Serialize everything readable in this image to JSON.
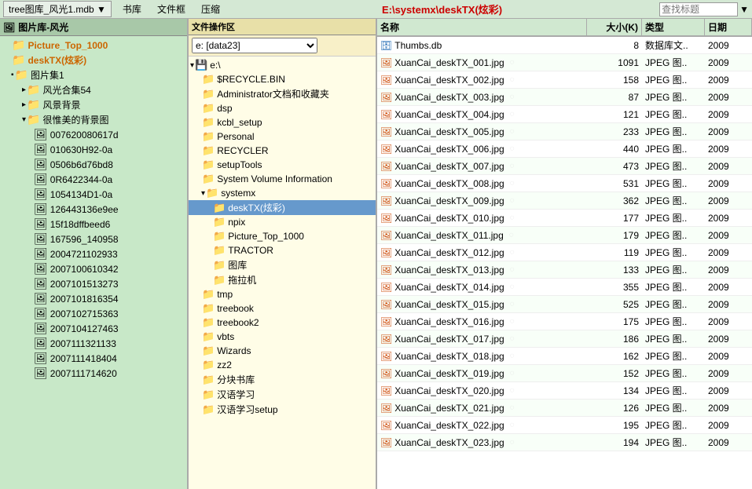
{
  "menubar": {
    "title_dropdown": "tree图库_风光1.mdb ▼",
    "menu_items": [
      "书库",
      "文件框",
      "压缩"
    ],
    "path": "E:\\systemx\\deskTX(炫彩)",
    "search_placeholder": "查找标题"
  },
  "left_panel": {
    "header_icon": "🖼",
    "header_label": "图片库-风光",
    "items": [
      {
        "label": "Picture_Top_1000",
        "indent": 1,
        "bold": true,
        "expand": "",
        "icon": "📁"
      },
      {
        "label": "deskTX(炫彩)",
        "indent": 1,
        "bold": true,
        "expand": "",
        "icon": "📁"
      },
      {
        "label": "图片集1",
        "indent": 1,
        "bold": false,
        "expand": "▪",
        "icon": "📁"
      },
      {
        "label": "风光合集54",
        "indent": 2,
        "bold": false,
        "expand": "▸",
        "icon": "📁"
      },
      {
        "label": "风景背景",
        "indent": 2,
        "bold": false,
        "expand": "▸",
        "icon": "📁"
      },
      {
        "label": "很惟美的背景图",
        "indent": 2,
        "bold": false,
        "expand": "▾",
        "icon": "📁"
      },
      {
        "label": "007620080617d",
        "indent": 3,
        "bold": false,
        "expand": "",
        "icon": "🖼"
      },
      {
        "label": "010630H92-0a",
        "indent": 3,
        "bold": false,
        "expand": "",
        "icon": "🖼"
      },
      {
        "label": "0506b6d76bd8",
        "indent": 3,
        "bold": false,
        "expand": "",
        "icon": "🖼"
      },
      {
        "label": "0R6422344-0a",
        "indent": 3,
        "bold": false,
        "expand": "",
        "icon": "🖼"
      },
      {
        "label": "1054134D1-0a",
        "indent": 3,
        "bold": false,
        "expand": "",
        "icon": "🖼"
      },
      {
        "label": "126443136e9ee",
        "indent": 3,
        "bold": false,
        "expand": "",
        "icon": "🖼"
      },
      {
        "label": "15f18dffbeed6",
        "indent": 3,
        "bold": false,
        "expand": "",
        "icon": "🖼"
      },
      {
        "label": "167596_140958",
        "indent": 3,
        "bold": false,
        "expand": "",
        "icon": "🖼"
      },
      {
        "label": "2004721102933",
        "indent": 3,
        "bold": false,
        "expand": "",
        "icon": "🖼"
      },
      {
        "label": "2007100610342",
        "indent": 3,
        "bold": false,
        "expand": "",
        "icon": "🖼"
      },
      {
        "label": "2007101513273",
        "indent": 3,
        "bold": false,
        "expand": "",
        "icon": "🖼"
      },
      {
        "label": "2007101816354",
        "indent": 3,
        "bold": false,
        "expand": "",
        "icon": "🖼"
      },
      {
        "label": "2007102715363",
        "indent": 3,
        "bold": false,
        "expand": "",
        "icon": "🖼"
      },
      {
        "label": "2007104127463",
        "indent": 3,
        "bold": false,
        "expand": "",
        "icon": "🖼"
      },
      {
        "label": "2007111321133",
        "indent": 3,
        "bold": false,
        "expand": "",
        "icon": "🖼"
      },
      {
        "label": "2007111418404",
        "indent": 3,
        "bold": false,
        "expand": "",
        "icon": "🖼"
      },
      {
        "label": "2007111714620",
        "indent": 3,
        "bold": false,
        "expand": "",
        "icon": "🖼"
      }
    ]
  },
  "mid_panel": {
    "header_label": "文件操作区",
    "drive_label": "e: [data23]",
    "items": [
      {
        "label": "e:\\",
        "indent": 0,
        "icon": "💾",
        "expand": "▾"
      },
      {
        "label": "$RECYCLE.BIN",
        "indent": 1,
        "icon": "📁",
        "expand": ""
      },
      {
        "label": "Administrator文档和收藏夹",
        "indent": 1,
        "icon": "📁",
        "expand": ""
      },
      {
        "label": "dsp",
        "indent": 1,
        "icon": "📁",
        "expand": ""
      },
      {
        "label": "kcbl_setup",
        "indent": 1,
        "icon": "📁",
        "expand": ""
      },
      {
        "label": "Personal",
        "indent": 1,
        "icon": "📁",
        "expand": ""
      },
      {
        "label": "RECYCLER",
        "indent": 1,
        "icon": "📁",
        "expand": ""
      },
      {
        "label": "setupTools",
        "indent": 1,
        "icon": "📁",
        "expand": ""
      },
      {
        "label": "System Volume Information",
        "indent": 1,
        "icon": "📁",
        "expand": ""
      },
      {
        "label": "systemx",
        "indent": 1,
        "icon": "📁",
        "expand": "▾"
      },
      {
        "label": "deskTX(炫彩)",
        "indent": 2,
        "icon": "📁",
        "expand": "",
        "selected": true
      },
      {
        "label": "npix",
        "indent": 2,
        "icon": "📁",
        "expand": ""
      },
      {
        "label": "Picture_Top_1000",
        "indent": 2,
        "icon": "📁",
        "expand": ""
      },
      {
        "label": "TRACTOR",
        "indent": 2,
        "icon": "📁",
        "expand": ""
      },
      {
        "label": "图库",
        "indent": 2,
        "icon": "📁",
        "expand": ""
      },
      {
        "label": "拖拉机",
        "indent": 2,
        "icon": "📁",
        "expand": ""
      },
      {
        "label": "tmp",
        "indent": 1,
        "icon": "📁",
        "expand": ""
      },
      {
        "label": "treebook",
        "indent": 1,
        "icon": "📁",
        "expand": ""
      },
      {
        "label": "treebook2",
        "indent": 1,
        "icon": "📁",
        "expand": ""
      },
      {
        "label": "vbts",
        "indent": 1,
        "icon": "📁",
        "expand": ""
      },
      {
        "label": "Wizards",
        "indent": 1,
        "icon": "📁",
        "expand": ""
      },
      {
        "label": "zz2",
        "indent": 1,
        "icon": "📁",
        "expand": ""
      },
      {
        "label": "分块书库",
        "indent": 1,
        "icon": "📁",
        "expand": ""
      },
      {
        "label": "汉语学习",
        "indent": 1,
        "icon": "📁",
        "expand": ""
      },
      {
        "label": "汉语学习setup",
        "indent": 1,
        "icon": "📁",
        "expand": ""
      }
    ]
  },
  "right_panel": {
    "columns": [
      "名称",
      "大小(K)",
      "类型",
      "日期"
    ],
    "files": [
      {
        "name": "Thumbs.db",
        "size": "8",
        "type": "数据库文..",
        "date": "2009",
        "icon": "db"
      },
      {
        "name": "XuanCai_deskTX_001.jpg",
        "size": "1091",
        "type": "JPEG 图..",
        "date": "2009",
        "icon": "jpg"
      },
      {
        "name": "XuanCai_deskTX_002.jpg",
        "size": "158",
        "type": "JPEG 图..",
        "date": "2009",
        "icon": "jpg"
      },
      {
        "name": "XuanCai_deskTX_003.jpg",
        "size": "87",
        "type": "JPEG 图..",
        "date": "2009",
        "icon": "jpg"
      },
      {
        "name": "XuanCai_deskTX_004.jpg",
        "size": "121",
        "type": "JPEG 图..",
        "date": "2009",
        "icon": "jpg"
      },
      {
        "name": "XuanCai_deskTX_005.jpg",
        "size": "233",
        "type": "JPEG 图..",
        "date": "2009",
        "icon": "jpg"
      },
      {
        "name": "XuanCai_deskTX_006.jpg",
        "size": "440",
        "type": "JPEG 图..",
        "date": "2009",
        "icon": "jpg"
      },
      {
        "name": "XuanCai_deskTX_007.jpg",
        "size": "473",
        "type": "JPEG 图..",
        "date": "2009",
        "icon": "jpg"
      },
      {
        "name": "XuanCai_deskTX_008.jpg",
        "size": "531",
        "type": "JPEG 图..",
        "date": "2009",
        "icon": "jpg"
      },
      {
        "name": "XuanCai_deskTX_009.jpg",
        "size": "362",
        "type": "JPEG 图..",
        "date": "2009",
        "icon": "jpg"
      },
      {
        "name": "XuanCai_deskTX_010.jpg",
        "size": "177",
        "type": "JPEG 图..",
        "date": "2009",
        "icon": "jpg"
      },
      {
        "name": "XuanCai_deskTX_011.jpg",
        "size": "179",
        "type": "JPEG 图..",
        "date": "2009",
        "icon": "jpg"
      },
      {
        "name": "XuanCai_deskTX_012.jpg",
        "size": "119",
        "type": "JPEG 图..",
        "date": "2009",
        "icon": "jpg"
      },
      {
        "name": "XuanCai_deskTX_013.jpg",
        "size": "133",
        "type": "JPEG 图..",
        "date": "2009",
        "icon": "jpg"
      },
      {
        "name": "XuanCai_deskTX_014.jpg",
        "size": "355",
        "type": "JPEG 图..",
        "date": "2009",
        "icon": "jpg"
      },
      {
        "name": "XuanCai_deskTX_015.jpg",
        "size": "525",
        "type": "JPEG 图..",
        "date": "2009",
        "icon": "jpg"
      },
      {
        "name": "XuanCai_deskTX_016.jpg",
        "size": "175",
        "type": "JPEG 图..",
        "date": "2009",
        "icon": "jpg"
      },
      {
        "name": "XuanCai_deskTX_017.jpg",
        "size": "186",
        "type": "JPEG 图..",
        "date": "2009",
        "icon": "jpg"
      },
      {
        "name": "XuanCai_deskTX_018.jpg",
        "size": "162",
        "type": "JPEG 图..",
        "date": "2009",
        "icon": "jpg"
      },
      {
        "name": "XuanCai_deskTX_019.jpg",
        "size": "152",
        "type": "JPEG 图..",
        "date": "2009",
        "icon": "jpg"
      },
      {
        "name": "XuanCai_deskTX_020.jpg",
        "size": "134",
        "type": "JPEG 图..",
        "date": "2009",
        "icon": "jpg"
      },
      {
        "name": "XuanCai_deskTX_021.jpg",
        "size": "126",
        "type": "JPEG 图..",
        "date": "2009",
        "icon": "jpg"
      },
      {
        "name": "XuanCai_deskTX_022.jpg",
        "size": "195",
        "type": "JPEG 图..",
        "date": "2009",
        "icon": "jpg"
      },
      {
        "name": "XuanCai_deskTX_023.jpg",
        "size": "194",
        "type": "JPEG 图..",
        "date": "2009",
        "icon": "jpg"
      }
    ]
  }
}
